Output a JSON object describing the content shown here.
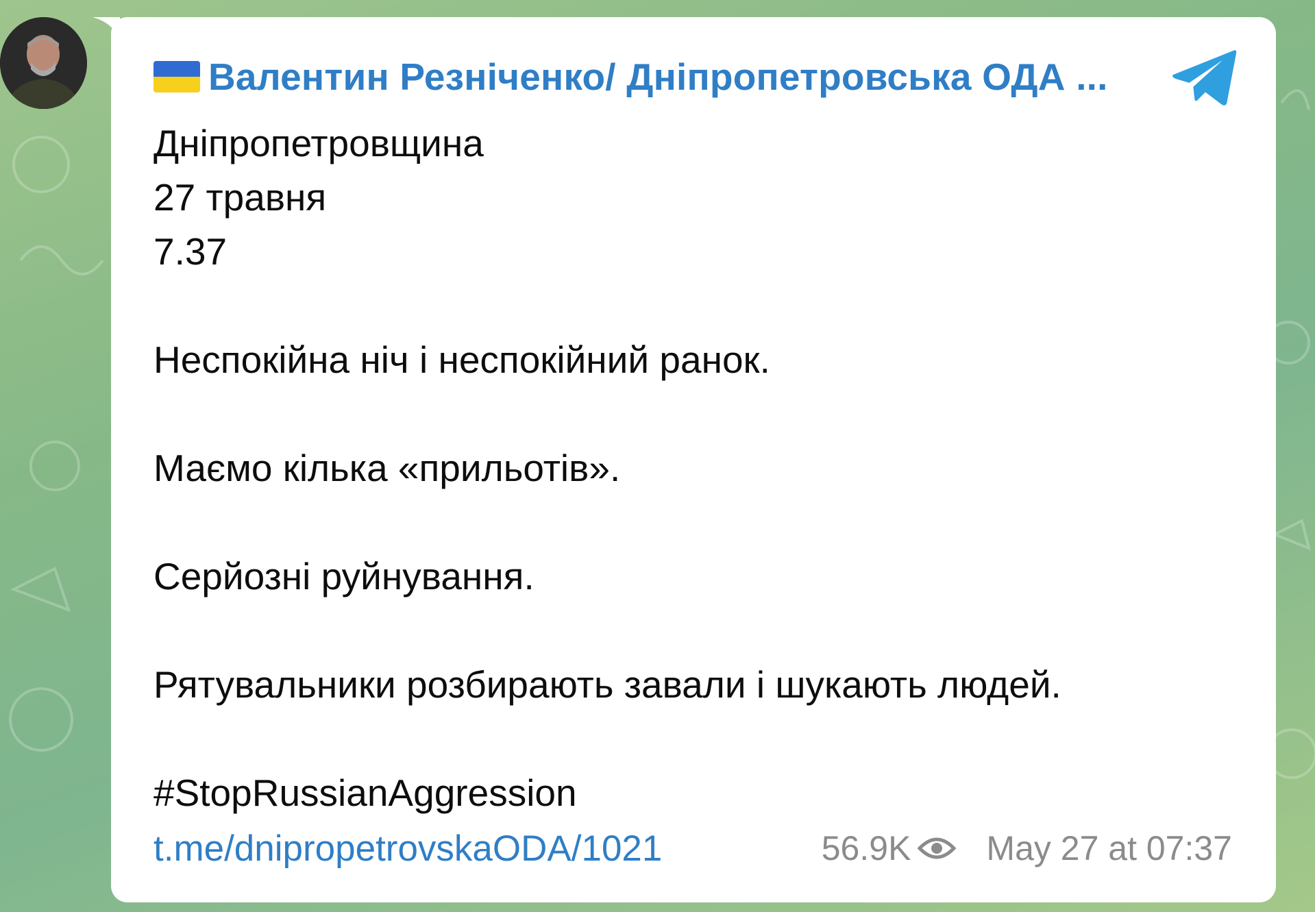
{
  "channel": {
    "name": "Валентин Резніченко/ Дніпропетровська ОДА ...",
    "flag_icon": "ukraine-flag-emoji",
    "avatar_icon": "channel-avatar",
    "app_icon": "telegram-icon"
  },
  "message": {
    "lines": [
      "Дніпропетровщина",
      "27 травня",
      "7.37",
      "",
      "Неспокійна ніч і неспокійний ранок.",
      "",
      "Маємо кілька «прильотів».",
      "",
      "Серйозні руйнування.",
      "",
      "Рятувальники розбирають завали і шукають людей.",
      "",
      "#StopRussianAggression"
    ]
  },
  "footer": {
    "link": "t.me/dnipropetrovskaODA/1021",
    "views": "56.9K",
    "views_icon": "eye-icon",
    "timestamp": "May 27 at 07:37"
  },
  "colors": {
    "accent": "#2f7ec6",
    "text": "#0d0d0d",
    "meta": "#8b8b8b",
    "background": "#86b887"
  }
}
